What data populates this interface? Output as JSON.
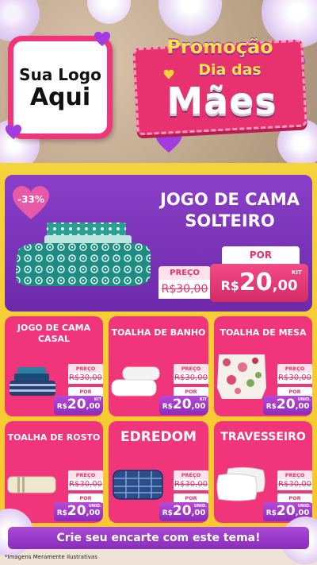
{
  "logo": {
    "line1": "Sua Logo",
    "line2": "Aqui"
  },
  "promo": {
    "line1": "Promoção",
    "line2": "Dia das",
    "line3": "Mães"
  },
  "featured": {
    "discount": "-33%",
    "title_line1": "JOGO DE CAMA",
    "title_line2": "SOLTEIRO",
    "price_label_old": "PREÇO",
    "price_old": "R$30,00",
    "price_label_new": "POR",
    "currency": "R$",
    "price_int": "20",
    "price_dec": ",00",
    "unit_tag": "KIT"
  },
  "cards": [
    {
      "title_line1": "JOGO DE CAMA",
      "title_line2": "CASAL",
      "preco_label": "PREÇO",
      "old": "R$30,00",
      "por_label": "POR",
      "currency": "R$",
      "int": "20",
      "dec": ",00",
      "unit": "KIT"
    },
    {
      "title_line1": "TOALHA DE BANHO",
      "title_line2": "",
      "preco_label": "PREÇO",
      "old": "R$30,00",
      "por_label": "POR",
      "currency": "R$",
      "int": "20",
      "dec": ",00",
      "unit": "KIT"
    },
    {
      "title_line1": "TOALHA DE MESA",
      "title_line2": "",
      "preco_label": "PREÇO",
      "old": "R$30,00",
      "por_label": "POR",
      "currency": "R$",
      "int": "20",
      "dec": ",00",
      "unit": "UNID."
    },
    {
      "title_line1": "TOALHA DE ROSTO",
      "title_line2": "",
      "preco_label": "PREÇO",
      "old": "R$30,00",
      "por_label": "POR",
      "currency": "R$",
      "int": "20",
      "dec": ",00",
      "unit": "UNID."
    },
    {
      "title_line1": "EDREDOM",
      "title_line2": "",
      "preco_label": "PREÇO",
      "old": "R$30,00",
      "por_label": "POR",
      "currency": "R$",
      "int": "20",
      "dec": ",00",
      "unit": "UNID."
    },
    {
      "title_line1": "TRAVESSEIRO",
      "title_line2": "",
      "preco_label": "PREÇO",
      "old": "R$30,00",
      "por_label": "POR",
      "currency": "R$",
      "int": "20",
      "dec": ",00",
      "unit": "UNID."
    }
  ],
  "cta": "Crie seu encarte com este tema!",
  "disclaimer": "*Imagens Meramente Ilustrativas",
  "colors": {
    "pink": "#f0357a",
    "purple": "#8a3fc8",
    "yellow": "#f6d33a",
    "price_purple": "#8b2cb8"
  },
  "icons": [
    "heart-icon",
    "flower-icon",
    "bedding-image",
    "towel-image",
    "tablecloth-image",
    "comforter-image",
    "pillow-image"
  ]
}
